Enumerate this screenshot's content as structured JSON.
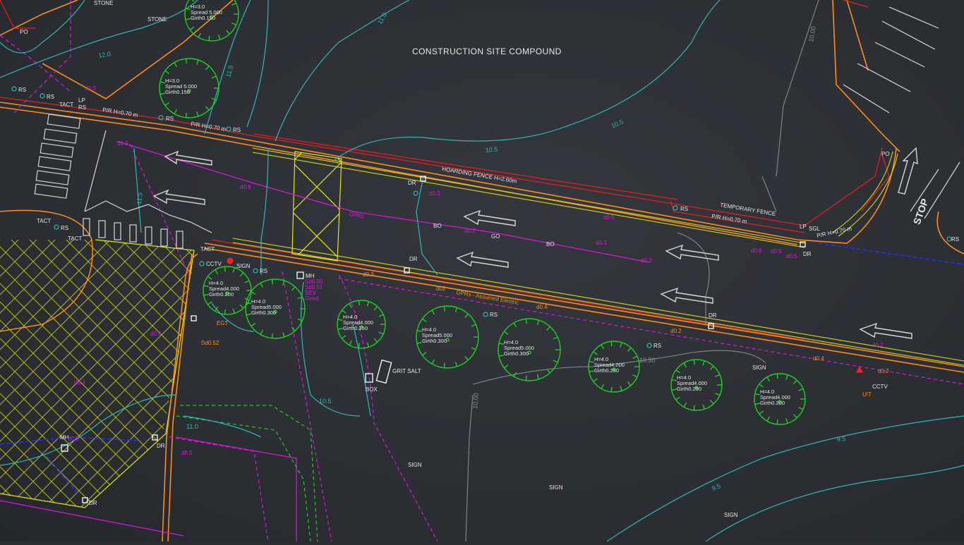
{
  "drawing": {
    "title": "CONSTRUCTION SITE COMPOUND",
    "fences": {
      "hoarding": "HOARDING FENCE H=2.60m",
      "temporary": "TEMPORARY FENCE",
      "pir1": "P/R H=0.70 m",
      "pir2": "P/R H=0.70 m",
      "pir3": "P/R H=0.70 m",
      "pir4": "P/R H=0.70 m"
    },
    "services": {
      "gpr_electric": "GPRs - Assumed Electric",
      "gpr": "GPRs"
    },
    "features": {
      "grit_salt": "GRIT SALT",
      "box": "BOX",
      "stop": "STOP",
      "mh": "MH",
      "cctv": "CCTV",
      "uit": "UIT",
      "egt": "EGT",
      "tact": "TACT",
      "stone": "STONE",
      "lp": "LP",
      "po": "PO",
      "sign": "SIGN",
      "rs": "RS",
      "dr": "DR",
      "bo": "BO",
      "go": "GO",
      "sgl": "SGL"
    },
    "mh_details": [
      "Sd0.50",
      "Sd0.51",
      "SEV",
      "Gired"
    ],
    "sd_label": "Sd0.52",
    "trees": [
      {
        "h": "H=3.0",
        "spread": "Spread 5.000",
        "girth": "Girth0.150"
      },
      {
        "h": "H=3.0",
        "spread": "Spread 5.000",
        "girth": "Girth0.150"
      },
      {
        "h": "H=4.0",
        "spread": "Spread4.000",
        "girth": "Girth0.200"
      },
      {
        "h": "H=4.0",
        "spread": "Spread5.000",
        "girth": "Girth0.300"
      },
      {
        "h": "H=4.0",
        "spread": "Spread4.000",
        "girth": "Girth0.250"
      },
      {
        "h": "H=4.0",
        "spread": "Spread5.000",
        "girth": "Girth0.300"
      },
      {
        "h": "H=4.0",
        "spread": "Spread5.000",
        "girth": "Girth0.300"
      },
      {
        "h": "H=4.0",
        "spread": "Spread4.000",
        "girth": "Girth0.250"
      },
      {
        "h": "H=4.0",
        "spread": "Spread4.000",
        "girth": "Girth0.250"
      },
      {
        "h": "H=4.0",
        "spread": "Spread4.000",
        "girth": "Girth0.200"
      }
    ],
    "contours": [
      "12.0",
      "11.5",
      "11.0",
      "10.5",
      "10.00",
      "9.5",
      "10.50",
      "10.00"
    ],
    "depths": [
      "d0.3",
      "d0.4",
      "d0.2",
      "d0.5",
      "d02",
      "d0.6"
    ],
    "colors": {
      "background": "#2b2e33",
      "kerb": "#ff8c1a",
      "fence": "#e02020",
      "contour": "#2fb8b8",
      "services": "#e014e0",
      "trees": "#1fcf1f",
      "hatch": "#e6e61a",
      "water": "#2030ff",
      "existing_contour": "#8a8a8a"
    }
  }
}
